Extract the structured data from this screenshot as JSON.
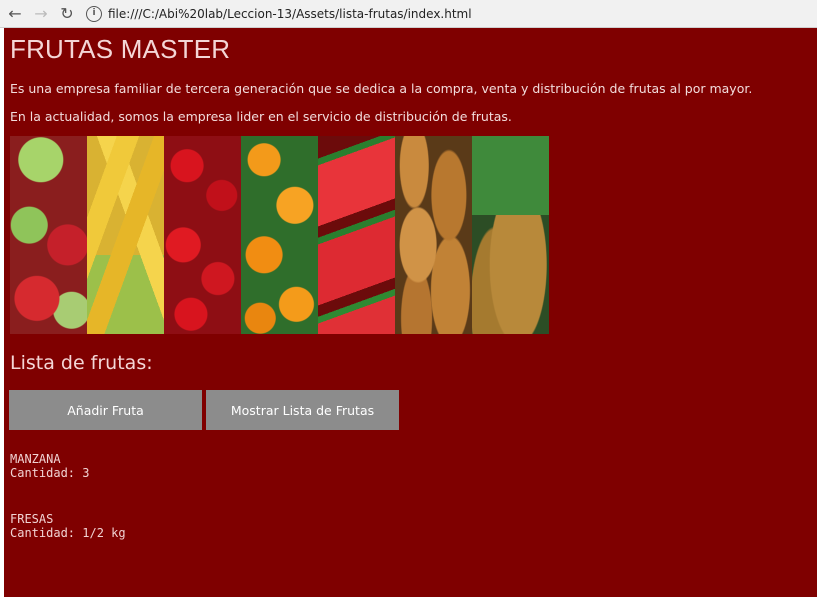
{
  "browser": {
    "url": "file:///C:/Abi%20lab/Leccion-13/Assets/lista-frutas/index.html",
    "back_icon": "arrow-left-icon",
    "forward_icon": "arrow-right-icon",
    "reload_icon": "reload-icon",
    "info_icon": "info-icon"
  },
  "page": {
    "title": "FRUTAS MASTER",
    "paragraphs": [
      "Es una empresa familiar de tercera generación que se dedica a la compra, venta y distribución de frutas al por mayor.",
      "En la actualidad, somos la empresa lider en el servicio de distribución de frutas."
    ],
    "section_title": "Lista de frutas:",
    "buttons": {
      "add": "Añadir Fruta",
      "show": "Mostrar Lista de Frutas"
    },
    "fruits": [
      {
        "name": "MANZANA",
        "quantity": "Cantidad: 3"
      },
      {
        "name": "FRESAS",
        "quantity": "Cantidad: 1/2 kg"
      }
    ],
    "colors": {
      "background": "#7f0000",
      "button": "#8c8c8c"
    }
  }
}
